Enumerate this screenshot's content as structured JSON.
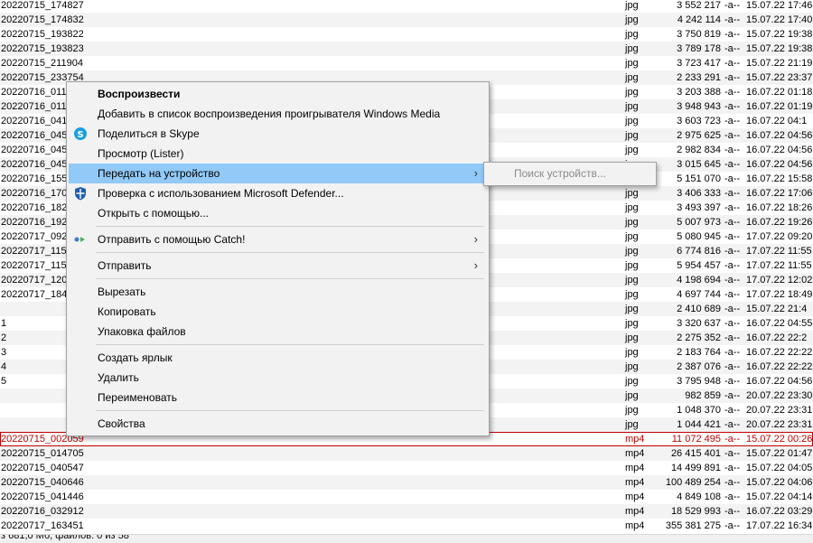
{
  "file_list": {
    "rows": [
      {
        "name": "20220715_174827",
        "ext": "jpg",
        "size": "3 552 217",
        "attr": "-a--",
        "date": "15.07.22 17:46"
      },
      {
        "name": "20220715_174832",
        "ext": "jpg",
        "size": "4 242 114",
        "attr": "-a--",
        "date": "15.07.22 17:40"
      },
      {
        "name": "20220715_193822",
        "ext": "jpg",
        "size": "3 750 819",
        "attr": "-a--",
        "date": "15.07.22 19:38"
      },
      {
        "name": "20220715_193823",
        "ext": "jpg",
        "size": "3 789 178",
        "attr": "-a--",
        "date": "15.07.22 19:38"
      },
      {
        "name": "20220715_211904",
        "ext": "jpg",
        "size": "3 723 417",
        "attr": "-a--",
        "date": "15.07.22 21:19"
      },
      {
        "name": "20220715_233754",
        "ext": "jpg",
        "size": "2 233 291",
        "attr": "-a--",
        "date": "15.07.22 23:37"
      },
      {
        "name": "20220716_011",
        "ext": "jpg",
        "size": "3 203 388",
        "attr": "-a--",
        "date": "16.07.22 01:18"
      },
      {
        "name": "20220716_011",
        "ext": "jpg",
        "size": "3 948 943",
        "attr": "-a--",
        "date": "16.07.22 01:19"
      },
      {
        "name": "20220716_041",
        "ext": "jpg",
        "size": "3 603 723",
        "attr": "-a--",
        "date": "16.07.22 04:1"
      },
      {
        "name": "20220716_045",
        "ext": "jpg",
        "size": "2 975 625",
        "attr": "-a--",
        "date": "16.07.22 04:56"
      },
      {
        "name": "20220716_045",
        "ext": "jpg",
        "size": "2 982 834",
        "attr": "-a--",
        "date": "16.07.22 04:56"
      },
      {
        "name": "20220716_045",
        "ext": "jpg",
        "size": "3 015 645",
        "attr": "-a--",
        "date": "16.07.22 04:56"
      },
      {
        "name": "20220716_155",
        "ext": "jpg",
        "size": "5 151 070",
        "attr": "-a--",
        "date": "16.07.22 15:58"
      },
      {
        "name": "20220716_170",
        "ext": "jpg",
        "size": "3 406 333",
        "attr": "-a--",
        "date": "16.07.22 17:06"
      },
      {
        "name": "20220716_182",
        "ext": "jpg",
        "size": "3 493 397",
        "attr": "-a--",
        "date": "16.07.22 18:26"
      },
      {
        "name": "20220716_192",
        "ext": "jpg",
        "size": "5 007 973",
        "attr": "-a--",
        "date": "16.07.22 19:26"
      },
      {
        "name": "20220717_092",
        "ext": "jpg",
        "size": "5 080 945",
        "attr": "-a--",
        "date": "17.07.22 09:20"
      },
      {
        "name": "20220717_115",
        "ext": "jpg",
        "size": "6 774 816",
        "attr": "-a--",
        "date": "17.07.22 11:55"
      },
      {
        "name": "20220717_115",
        "ext": "jpg",
        "size": "5 954 457",
        "attr": "-a--",
        "date": "17.07.22 11:55"
      },
      {
        "name": "20220717_120",
        "ext": "jpg",
        "size": "4 198 694",
        "attr": "-a--",
        "date": "17.07.22 12:02"
      },
      {
        "name": "20220717_184",
        "ext": "jpg",
        "size": "4 697 744",
        "attr": "-a--",
        "date": "17.07.22 18:49"
      },
      {
        "name": "",
        "ext": "jpg",
        "size": "2 410 689",
        "attr": "-a--",
        "date": "15.07.22 21:4"
      },
      {
        "name": "1",
        "ext": "jpg",
        "size": "3 320 637",
        "attr": "-a--",
        "date": "16.07.22 04:55"
      },
      {
        "name": "2",
        "ext": "jpg",
        "size": "2 275 352",
        "attr": "-a--",
        "date": "16.07.22 22:2"
      },
      {
        "name": "3",
        "ext": "jpg",
        "size": "2 183 764",
        "attr": "-a--",
        "date": "16.07.22 22:22"
      },
      {
        "name": "4",
        "ext": "jpg",
        "size": "2 387 076",
        "attr": "-a--",
        "date": "16.07.22 22:22"
      },
      {
        "name": "5",
        "ext": "jpg",
        "size": "3 795 948",
        "attr": "-a--",
        "date": "16.07.22 04:56"
      },
      {
        "name": "",
        "ext": "jpg",
        "size": "982 859",
        "attr": "-a--",
        "date": "20.07.22 23:30"
      },
      {
        "name": "",
        "ext": "jpg",
        "size": "1 048 370",
        "attr": "-a--",
        "date": "20.07.22 23:31"
      },
      {
        "name": "",
        "ext": "jpg",
        "size": "1 044 421",
        "attr": "-a--",
        "date": "20.07.22 23:31"
      },
      {
        "name": "20220715_002059",
        "ext": "mp4",
        "size": "11 072 495",
        "attr": "-a--",
        "date": "15.07.22 00:26",
        "selected": true
      },
      {
        "name": "20220715_014705",
        "ext": "mp4",
        "size": "26 415 401",
        "attr": "-a--",
        "date": "15.07.22 01:47"
      },
      {
        "name": "20220715_040547",
        "ext": "mp4",
        "size": "14 499 891",
        "attr": "-a--",
        "date": "15.07.22 04:05"
      },
      {
        "name": "20220715_040646",
        "ext": "mp4",
        "size": "100 489 254",
        "attr": "-a--",
        "date": "15.07.22 04:06"
      },
      {
        "name": "20220715_041446",
        "ext": "mp4",
        "size": "4 849 108",
        "attr": "-a--",
        "date": "15.07.22 04:14"
      },
      {
        "name": "20220716_032912",
        "ext": "mp4",
        "size": "18 529 993",
        "attr": "-a--",
        "date": "16.07.22 03:29"
      },
      {
        "name": "20220717_163451",
        "ext": "mp4",
        "size": "355 381 275",
        "attr": "-a--",
        "date": "17.07.22 16:34"
      }
    ]
  },
  "status_bar": {
    "text": "з 681,0 Мб, файлов: 0 из 58"
  },
  "context_menu": {
    "items": [
      {
        "type": "item",
        "label": "Воспроизвести",
        "bold": true,
        "icon": ""
      },
      {
        "type": "item",
        "label": "Добавить в список воспроизведения проигрывателя Windows Media",
        "icon": ""
      },
      {
        "type": "item",
        "label": "Поделиться в Skype",
        "icon": "skype-icon"
      },
      {
        "type": "item",
        "label": "Просмотр (Lister)",
        "icon": ""
      },
      {
        "type": "item",
        "label": "Передать на устройство",
        "icon": "",
        "submenu": true,
        "active": true
      },
      {
        "type": "item",
        "label": "Проверка с использованием Microsoft Defender...",
        "icon": "defender-shield-icon"
      },
      {
        "type": "item",
        "label": "Открыть с помощью...",
        "icon": ""
      },
      {
        "type": "separator"
      },
      {
        "type": "item",
        "label": "Отправить с помощью Catch!",
        "icon": "catch-icon",
        "submenu": true
      },
      {
        "type": "separator"
      },
      {
        "type": "item",
        "label": "Отправить",
        "icon": "",
        "submenu": true
      },
      {
        "type": "separator"
      },
      {
        "type": "item",
        "label": "Вырезать",
        "icon": ""
      },
      {
        "type": "item",
        "label": "Копировать",
        "icon": ""
      },
      {
        "type": "item",
        "label": "Упаковка файлов",
        "icon": ""
      },
      {
        "type": "separator"
      },
      {
        "type": "item",
        "label": "Создать ярлык",
        "icon": ""
      },
      {
        "type": "item",
        "label": "Удалить",
        "icon": ""
      },
      {
        "type": "item",
        "label": "Переименовать",
        "icon": ""
      },
      {
        "type": "separator"
      },
      {
        "type": "item",
        "label": "Свойства",
        "icon": ""
      }
    ],
    "submenu_arrow": "›",
    "colors": {
      "highlight": "#91c9f7",
      "skype": "#1a9fe0",
      "defender": "#1f5fae",
      "catch_blue": "#3a7bd5",
      "catch_green": "#4caf50"
    }
  },
  "submenu": {
    "placeholder_item": "Поиск устройств..."
  }
}
